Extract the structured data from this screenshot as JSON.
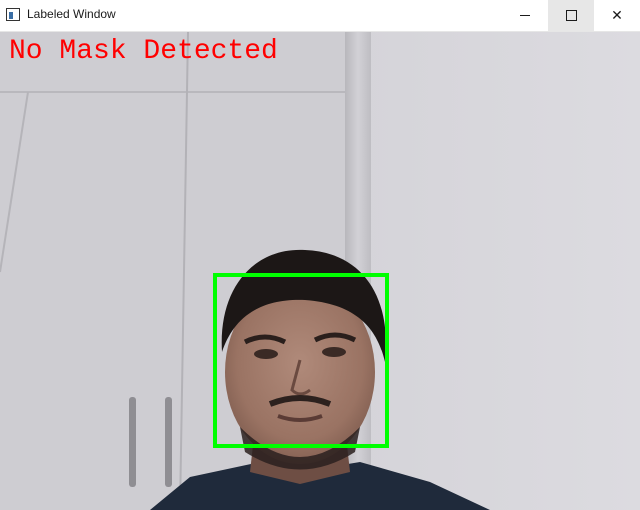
{
  "window": {
    "title": "Labeled Window",
    "controls": {
      "minimize_icon": "minimize-icon",
      "maximize_icon": "maximize-icon",
      "close_icon": "close-icon",
      "close_glyph": "✕"
    }
  },
  "overlay": {
    "label": "No Mask Detected",
    "label_color": "#ff0000",
    "box_color": "#00ff00"
  }
}
